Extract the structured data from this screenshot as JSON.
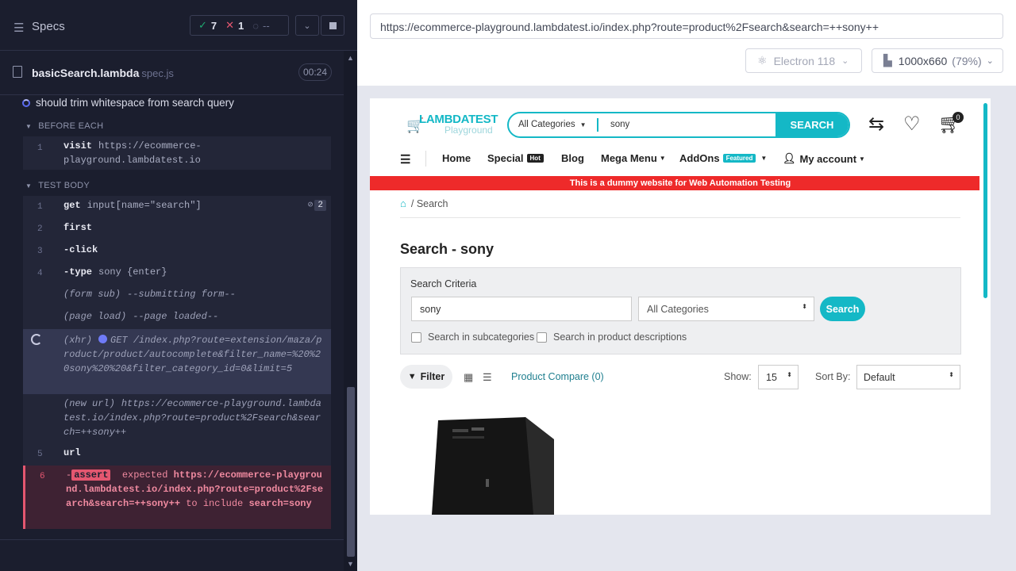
{
  "runner": {
    "specs_label": "Specs",
    "stats": {
      "passed": "7",
      "failed": "1",
      "pending": "--"
    },
    "file": {
      "name": "basicSearch.lambda",
      "ext": "spec.js",
      "duration": "00:24"
    },
    "test_title": "should trim whitespace from search query",
    "before_each_label": "BEFORE EACH",
    "test_body_label": "TEST BODY",
    "before_each_cmds": [
      {
        "num": "1",
        "name": "visit",
        "msg": "https://ecommerce-playground.lambdatest.io"
      }
    ],
    "body_cmds": [
      {
        "num": "1",
        "name": "get",
        "msg": "input[name=\"search\"]",
        "hidden_count": "2"
      },
      {
        "num": "2",
        "name": "first",
        "msg": ""
      },
      {
        "num": "3",
        "name": "-click",
        "msg": ""
      },
      {
        "num": "4",
        "name": "-type",
        "msg": "sony {enter}"
      },
      {
        "num": "",
        "name": "(form sub)",
        "msg": "--submitting form--"
      },
      {
        "num": "",
        "name": "(page load)",
        "msg": "--page loaded--"
      },
      {
        "num": "",
        "name": "(xhr)",
        "msg": "GET /index.php?route=extension/maza/product/product/autocomplete&filter_name=%20%20sony%20%20&filter_category_id=0&limit=5"
      },
      {
        "num": "",
        "name": "(new url)",
        "msg": "https://ecommerce-playground.lambdatest.io/index.php?route=product%2Fsearch&search=++sony++"
      },
      {
        "num": "5",
        "name": "url",
        "msg": ""
      },
      {
        "num": "6",
        "name": "-assert",
        "msg": "expected https://ecommerce-playground.lambdatest.io/index.php?route=product%2Fsearch&search=++sony++ to include search=sony"
      }
    ],
    "assert_parts": {
      "prefix": "-",
      "badge": "assert",
      "expected": "expected",
      "url": "https://ecommerce-playground.lambdatest.io/index.php?route=product%2Fsearch&search=++sony++",
      "to_include": "to include",
      "value": "search=sony"
    }
  },
  "browser": {
    "url": "https://ecommerce-playground.lambdatest.io/index.php?route=product%2Fsearch&search=++sony++",
    "engine": "Electron 118",
    "viewport": "1000x660",
    "zoom": "(79%)"
  },
  "site": {
    "logo_main": "LAMBDATEST",
    "logo_sub": "Playground",
    "category_label": "All Categories",
    "search_value": "sony",
    "search_button": "SEARCH",
    "cart_count": "0",
    "nav": {
      "home": "Home",
      "special": "Special",
      "special_tag": "Hot",
      "blog": "Blog",
      "mega_menu": "Mega Menu",
      "addons": "AddOns",
      "addons_tag": "Featured",
      "account": "My account"
    },
    "banner": "This is a dummy website for Web Automation Testing",
    "breadcrumb": "Search",
    "page_title": "Search - sony",
    "criteria_label": "Search Criteria",
    "criteria_value": "sony",
    "criteria_category": "All Categories",
    "criteria_button": "Search",
    "chk_subcategories": "Search in subcategories",
    "chk_descriptions": "Search in product descriptions",
    "filter_button": "Filter",
    "product_compare": "Product Compare (0)",
    "show_label": "Show:",
    "show_value": "15",
    "sort_label": "Sort By:",
    "sort_value": "Default"
  },
  "colors": {
    "accent": "#14b8c6",
    "fail": "#e45770",
    "banner": "#ee2a2a",
    "runner_bg": "#1b1e2e"
  }
}
